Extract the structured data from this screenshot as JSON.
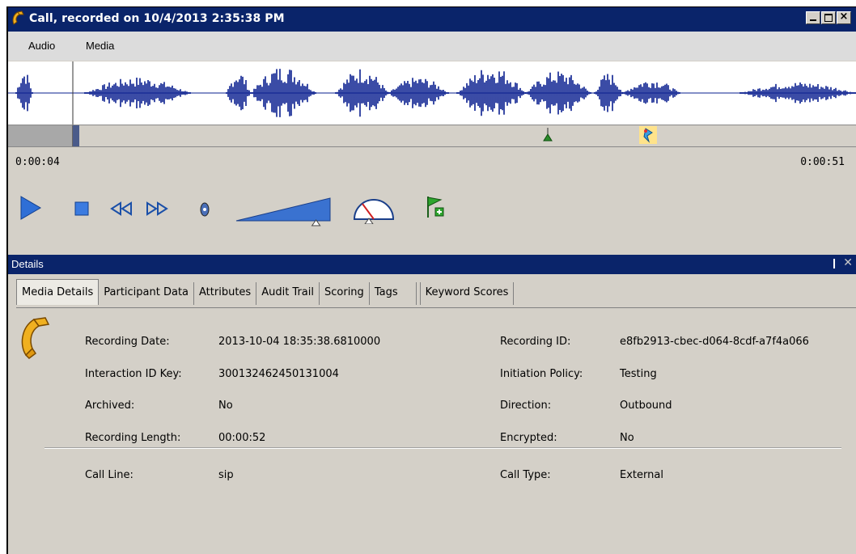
{
  "window": {
    "title": "Call, recorded on 10/4/2013 2:35:38 PM"
  },
  "menu": [
    "Audio",
    "Media"
  ],
  "player": {
    "position_time": "0:00:04",
    "duration_time": "0:00:51",
    "progress": 0.075,
    "volume": 0.85,
    "speed": 0.5
  },
  "details": {
    "title": "Details",
    "pin_icon": "❙",
    "close_icon": "✕",
    "tabs": [
      "Media Details",
      "Participant Data",
      "Attributes",
      "Audit Trail",
      "Scoring",
      "Tags",
      "Keyword Scores"
    ],
    "active_tab": "Media Details",
    "left_fields": [
      {
        "label": "Recording Date:",
        "value": "2013-10-04 18:35:38.6810000"
      },
      {
        "label": "Interaction ID Key:",
        "value": "300132462450131004"
      },
      {
        "label": "Archived:",
        "value": "No"
      },
      {
        "label": "Recording Length:",
        "value": "00:00:52"
      }
    ],
    "right_fields": [
      {
        "label": "Recording ID:",
        "value": "e8fb2913-cbec-d064-8cdf-a7f4a066"
      },
      {
        "label": "Initiation Policy:",
        "value": "Testing"
      },
      {
        "label": "Direction:",
        "value": "Outbound"
      },
      {
        "label": "Encrypted:",
        "value": "No"
      }
    ],
    "extra_left": {
      "label": "Call Line:",
      "value": "sip"
    },
    "extra_right": {
      "label": "Call Type:",
      "value": "External"
    }
  },
  "colors": {
    "title_bar": "#0a246a",
    "waveform": "#0a1f8f",
    "play": "#2f6fd6"
  }
}
